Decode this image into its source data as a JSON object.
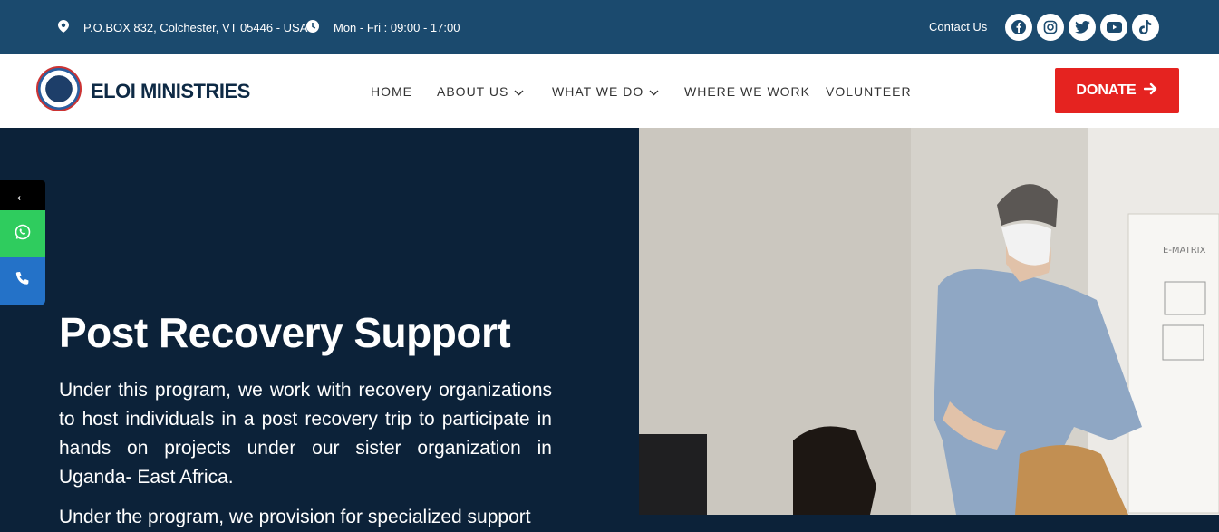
{
  "topbar": {
    "address": "P.O.BOX 832, Colchester, VT 05446 - USA",
    "hours": "Mon - Fri : 09:00 - 17:00",
    "contact_label": "Contact Us",
    "socials": [
      "facebook-icon",
      "instagram-icon",
      "twitter-icon",
      "youtube-icon",
      "tiktok-icon"
    ]
  },
  "brand": {
    "name": "ELOI MINISTRIES"
  },
  "nav": {
    "items": [
      {
        "label": "HOME",
        "dropdown": false
      },
      {
        "label": "ABOUT US",
        "dropdown": true
      },
      {
        "label": "WHAT WE DO",
        "dropdown": true
      },
      {
        "label": "WHERE WE WORK",
        "dropdown": false
      },
      {
        "label": "VOLUNTEER",
        "dropdown": false
      }
    ],
    "donate_label": "DONATE"
  },
  "sidebar": {
    "toggle": "←"
  },
  "hero": {
    "title": "Post Recovery Support",
    "paragraph": "Under this program, we work with recovery organizations to host individuals in a post recovery trip to participate in hands on projects under our sister organization in Uganda- East Africa.",
    "paragraph2_partial": "Under the program, we provision for specialized support",
    "photo_board_text": "E-MATRIX"
  },
  "colors": {
    "topbar": "#1b4a6e",
    "hero_bg": "#0c2239",
    "donate": "#e52320",
    "whatsapp": "#2fcc5e",
    "phone": "#2472c8"
  }
}
